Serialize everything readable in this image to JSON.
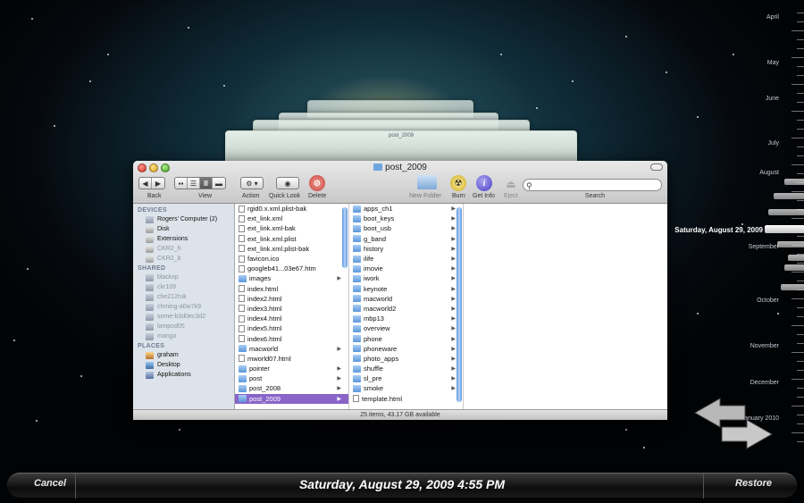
{
  "window": {
    "title": "post_2009",
    "ghost_title": "post_2009"
  },
  "toolbar": {
    "back_label": "Back",
    "view_label": "View",
    "action_label": "Action",
    "quicklook_label": "Quick Look",
    "delete_label": "Delete",
    "newfolder_label": "New Folder",
    "burn_label": "Burn",
    "getinfo_label": "Get Info",
    "eject_label": "Eject",
    "search_label": "Search",
    "search_placeholder": ""
  },
  "sidebar": {
    "devices_header": "DEVICES",
    "devices": [
      {
        "label": "Rogers' Computer (2)",
        "icon": "computer-icon",
        "dim": false
      },
      {
        "label": "Disk",
        "icon": "disk-icon",
        "dim": false
      },
      {
        "label": "Extensions",
        "icon": "disk-icon",
        "dim": false
      },
      {
        "label": "CKR2_h",
        "icon": "disk-icon",
        "dim": true
      },
      {
        "label": "CKR2_b",
        "icon": "disk-icon",
        "dim": true
      }
    ],
    "shared_header": "SHARED",
    "shared": [
      {
        "label": "blackxp"
      },
      {
        "label": "ckr109"
      },
      {
        "label": "che212ruk"
      },
      {
        "label": "chming-a0w7k9"
      },
      {
        "label": "some-b3d0ec3d2"
      },
      {
        "label": "lampod05"
      },
      {
        "label": "mango"
      }
    ],
    "places_header": "PLACES",
    "places": [
      {
        "label": "graham",
        "icon": "home-icon"
      },
      {
        "label": "Desktop",
        "icon": "desktop-icon"
      },
      {
        "label": "Applications",
        "icon": "applications-icon"
      }
    ]
  },
  "column1": [
    {
      "name": "rgid0.x.xml.plist-bak",
      "type": "file",
      "arrow": false
    },
    {
      "name": "ext_link.xml",
      "type": "file",
      "arrow": false
    },
    {
      "name": "ext_link.xml-bak",
      "type": "file",
      "arrow": false
    },
    {
      "name": "ext_link.xml.plist",
      "type": "file",
      "arrow": false
    },
    {
      "name": "ext_link.xml.plist-bak",
      "type": "file",
      "arrow": false
    },
    {
      "name": "favicon.ico",
      "type": "file",
      "arrow": false
    },
    {
      "name": "googleb41...03e67.htm",
      "type": "file",
      "arrow": false
    },
    {
      "name": "images",
      "type": "folder",
      "arrow": true
    },
    {
      "name": "index.html",
      "type": "file",
      "arrow": false
    },
    {
      "name": "index2.html",
      "type": "file",
      "arrow": false
    },
    {
      "name": "index3.html",
      "type": "file",
      "arrow": false
    },
    {
      "name": "index4.html",
      "type": "file",
      "arrow": false
    },
    {
      "name": "index5.html",
      "type": "file",
      "arrow": false
    },
    {
      "name": "index6.html",
      "type": "file",
      "arrow": false
    },
    {
      "name": "macworld",
      "type": "folder",
      "arrow": true
    },
    {
      "name": "mworld07.html",
      "type": "file",
      "arrow": false
    },
    {
      "name": "pointer",
      "type": "folder",
      "arrow": true
    },
    {
      "name": "post",
      "type": "folder",
      "arrow": true
    },
    {
      "name": "post_2008",
      "type": "folder",
      "arrow": true
    },
    {
      "name": "post_2009",
      "type": "folder",
      "arrow": true,
      "selected": true
    }
  ],
  "column2": [
    {
      "name": "apps_ch1",
      "type": "folder"
    },
    {
      "name": "boot_keys",
      "type": "folder"
    },
    {
      "name": "boot_usb",
      "type": "folder"
    },
    {
      "name": "g_band",
      "type": "folder"
    },
    {
      "name": "history",
      "type": "folder"
    },
    {
      "name": "ilife",
      "type": "folder"
    },
    {
      "name": "imovie",
      "type": "folder"
    },
    {
      "name": "iwork",
      "type": "folder"
    },
    {
      "name": "keynote",
      "type": "folder"
    },
    {
      "name": "macworld",
      "type": "folder"
    },
    {
      "name": "macworld2",
      "type": "folder"
    },
    {
      "name": "mbp13",
      "type": "folder"
    },
    {
      "name": "overview",
      "type": "folder"
    },
    {
      "name": "phone",
      "type": "folder"
    },
    {
      "name": "phoneware",
      "type": "folder"
    },
    {
      "name": "photo_apps",
      "type": "folder"
    },
    {
      "name": "shuffle",
      "type": "folder"
    },
    {
      "name": "sl_pre",
      "type": "folder"
    },
    {
      "name": "smoke",
      "type": "folder"
    },
    {
      "name": "template.html",
      "type": "file"
    }
  ],
  "status": "25 items, 43.17 GB available",
  "timeline": {
    "months": [
      "April",
      "May",
      "June",
      "July",
      "August",
      "September",
      "October",
      "November",
      "December",
      "January 2010"
    ],
    "selected_date": "Saturday, August 29, 2009"
  },
  "bottombar": {
    "cancel_label": "Cancel",
    "date_label": "Saturday, August 29, 2009 4:55 PM",
    "restore_label": "Restore"
  },
  "colors": {
    "selection": "#8a64c9",
    "sidebar_bg": "#dde3ea",
    "folder": "#5c97da"
  }
}
